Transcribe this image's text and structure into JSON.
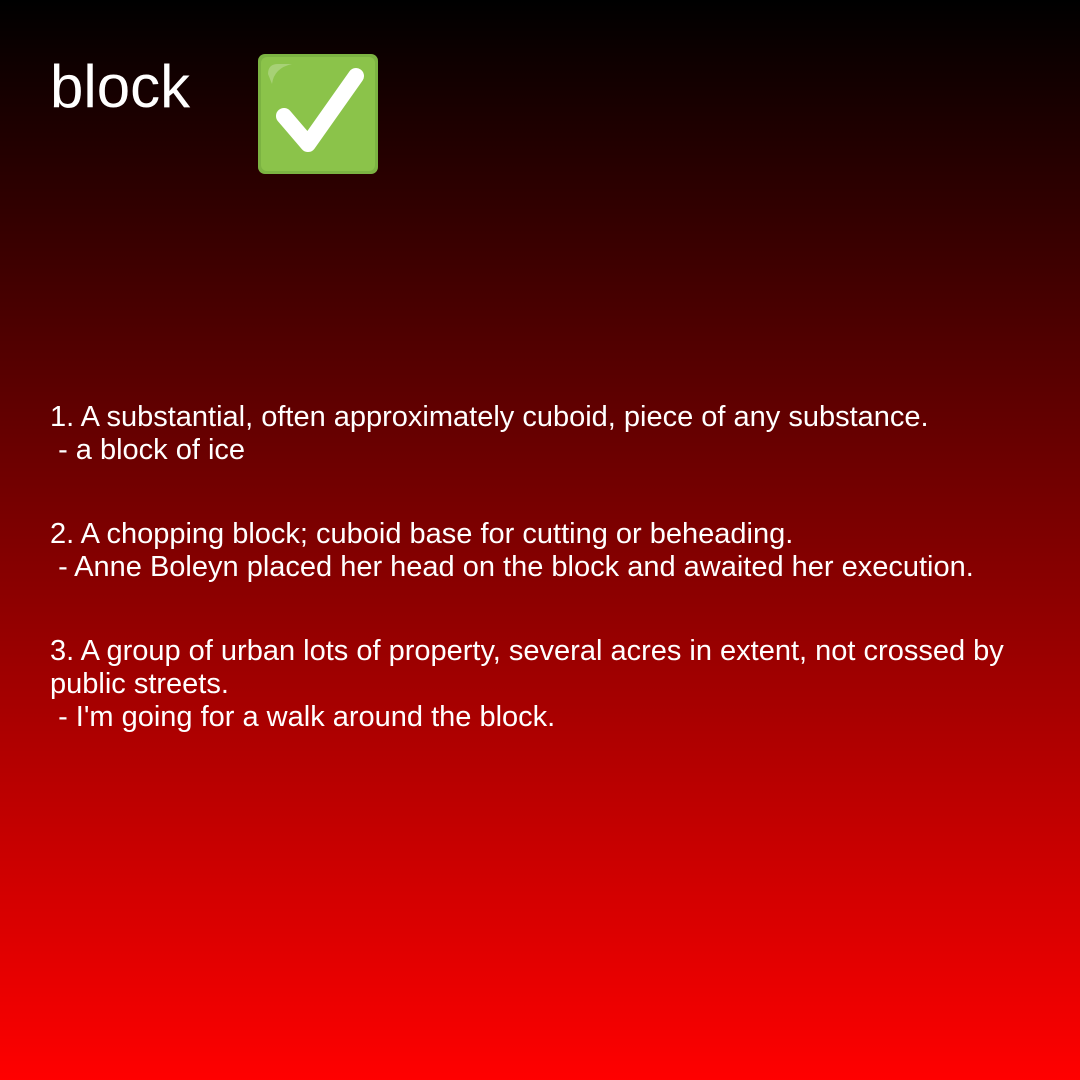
{
  "word": "block",
  "status_icon": "check-mark-button-icon",
  "colors": {
    "gradient_top": "#000000",
    "gradient_bottom": "#ff0000",
    "text": "#ffffff",
    "check_green": "#7cb342"
  },
  "definitions": [
    {
      "text": "1. A substantial, often approximately cuboid, piece of any substance.",
      "example": " - a block of ice"
    },
    {
      "text": "2. A chopping block; cuboid base for cutting or beheading.",
      "example": " - Anne Boleyn placed her head on the block and awaited her execution."
    },
    {
      "text": "3. A group of urban lots of property, several acres in extent, not crossed by public streets.",
      "example": " - I'm going for a walk around the block."
    }
  ]
}
